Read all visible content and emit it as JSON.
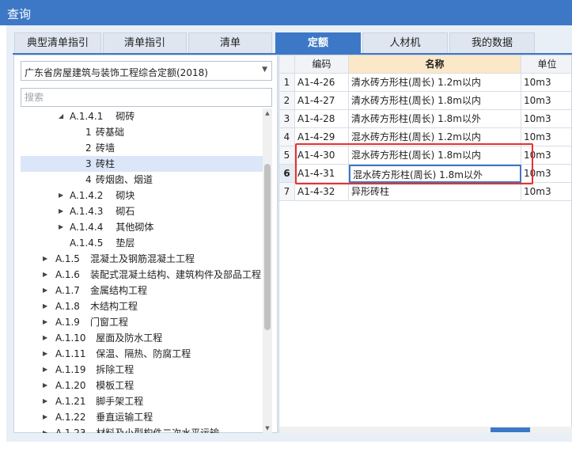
{
  "window": {
    "title": "查询"
  },
  "tabs": [
    {
      "label": "典型清单指引",
      "active": false
    },
    {
      "label": "清单指引",
      "active": false
    },
    {
      "label": "清单",
      "active": false
    },
    {
      "label": "定额",
      "active": true
    },
    {
      "label": "人材机",
      "active": false
    },
    {
      "label": "我的数据",
      "active": false
    }
  ],
  "quota_library": {
    "selected": "广东省房屋建筑与装饰工程综合定额(2018)"
  },
  "search": {
    "placeholder": "搜索",
    "value": ""
  },
  "tree": [
    {
      "code": "A.1.4.1",
      "label": "砌砖",
      "expanded": true,
      "level": 2
    },
    {
      "code": "1",
      "label": "砖基础",
      "level": 3
    },
    {
      "code": "2",
      "label": "砖墙",
      "level": 3
    },
    {
      "code": "3",
      "label": "砖柱",
      "level": 3,
      "selected": true
    },
    {
      "code": "4",
      "label": "砖烟囱、烟道",
      "level": 3
    },
    {
      "code": "A.1.4.2",
      "label": "砌块",
      "expanded": false,
      "level": 2
    },
    {
      "code": "A.1.4.3",
      "label": "砌石",
      "expanded": false,
      "level": 2
    },
    {
      "code": "A.1.4.4",
      "label": "其他砌体",
      "expanded": false,
      "level": 2
    },
    {
      "code": "A.1.4.5",
      "label": "垫层",
      "level": 2,
      "leaf": true
    },
    {
      "code": "A.1.5",
      "label": "混凝土及钢筋混凝土工程",
      "expanded": false,
      "level": 1
    },
    {
      "code": "A.1.6",
      "label": "装配式混凝土结构、建筑构件及部品工程",
      "expanded": false,
      "level": 1
    },
    {
      "code": "A.1.7",
      "label": "金属结构工程",
      "expanded": false,
      "level": 1
    },
    {
      "code": "A.1.8",
      "label": "木结构工程",
      "expanded": false,
      "level": 1
    },
    {
      "code": "A.1.9",
      "label": "门窗工程",
      "expanded": false,
      "level": 1
    },
    {
      "code": "A.1.10",
      "label": "屋面及防水工程",
      "expanded": false,
      "level": 1
    },
    {
      "code": "A.1.11",
      "label": "保温、隔热、防腐工程",
      "expanded": false,
      "level": 1
    },
    {
      "code": "A.1.19",
      "label": "拆除工程",
      "expanded": false,
      "level": 1
    },
    {
      "code": "A.1.20",
      "label": "模板工程",
      "expanded": false,
      "level": 1
    },
    {
      "code": "A.1.21",
      "label": "脚手架工程",
      "expanded": false,
      "level": 1
    },
    {
      "code": "A.1.22",
      "label": "垂直运输工程",
      "expanded": false,
      "level": 1
    },
    {
      "code": "A.1.23",
      "label": "材料及小型构件二次水平运输",
      "expanded": false,
      "level": 1
    }
  ],
  "table": {
    "headers": {
      "row": "",
      "code": "编码",
      "name": "名称",
      "unit": "单位"
    },
    "rows": [
      {
        "no": "1",
        "code": "A1-4-26",
        "name": "清水砖方形柱(周长) 1.2m以内",
        "unit": "10m3"
      },
      {
        "no": "2",
        "code": "A1-4-27",
        "name": "清水砖方形柱(周长) 1.8m以内",
        "unit": "10m3"
      },
      {
        "no": "3",
        "code": "A1-4-28",
        "name": "清水砖方形柱(周长) 1.8m以外",
        "unit": "10m3"
      },
      {
        "no": "4",
        "code": "A1-4-29",
        "name": "混水砖方形柱(周长) 1.2m以内",
        "unit": "10m3"
      },
      {
        "no": "5",
        "code": "A1-4-30",
        "name": "混水砖方形柱(周长) 1.8m以内",
        "unit": "10m3"
      },
      {
        "no": "6",
        "code": "A1-4-31",
        "name": "混水砖方形柱(周长) 1.8m以外",
        "unit": "10m3",
        "selected": true
      },
      {
        "no": "7",
        "code": "A1-4-32",
        "name": "异形砖柱",
        "unit": "10m3"
      }
    ]
  },
  "colors": {
    "accent": "#3d78c6",
    "highlight_box": "#e8312f",
    "header_name_bg": "#fbe8c8"
  }
}
